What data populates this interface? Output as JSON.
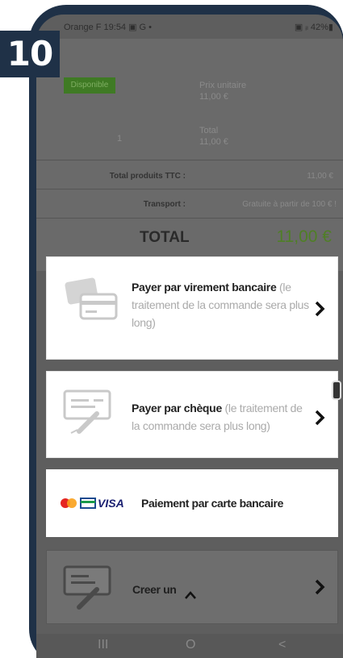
{
  "step": "10",
  "status_bar": {
    "left": "Orange F  19:54 ▣ G  •",
    "right": "▣ ᵢₗ 42%▮"
  },
  "cart": {
    "availability": "Disponible",
    "unit_price_label": "Prix unitaire",
    "unit_price_value": "11,00 €",
    "quantity": "1",
    "total_label": "Total",
    "total_value": "11,00 €",
    "total_products_label": "Total produits TTC :",
    "total_products_value": "11,00 €",
    "shipping_label": "Transport :",
    "shipping_value": "Gratuite à partir de 100 € !",
    "grand_total_label": "TOTAL",
    "grand_total_value": "11,00 €"
  },
  "payment": {
    "transfer": {
      "title": "Payer par virement bancaire",
      "note": "(le traitement de la commande sera plus long)"
    },
    "cheque": {
      "title": "Payer par chèque",
      "note": "(le traitement de la commande sera plus long)"
    },
    "card": {
      "logos": [
        "mastercard",
        "bank-card",
        "VISA"
      ],
      "visa_text": "VISA",
      "label": "Paiement par carte bancaire"
    },
    "create": {
      "label": "Creer un"
    }
  },
  "navbar": {
    "recent": "III",
    "home": "O",
    "back": "<"
  },
  "colors": {
    "frame": "#1f3147",
    "green": "#4f7f26",
    "dim": "#5e5e5e"
  }
}
